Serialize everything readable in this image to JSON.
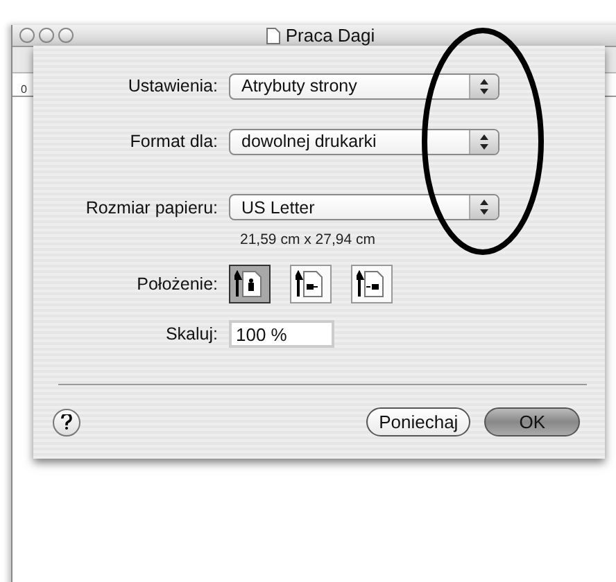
{
  "window": {
    "title": "Praca Dagi"
  },
  "ruler": {
    "label": "0"
  },
  "sheet": {
    "popups": [
      {
        "label": "Ustawienia:",
        "value": "Atrybuty strony"
      },
      {
        "label": "Format dla:",
        "value": "dowolnej drukarki"
      },
      {
        "label": "Rozmiar papieru:",
        "value": "US Letter"
      }
    ],
    "paper_size": "21,59 cm x 27,94 cm",
    "orientation": {
      "label": "Położenie:",
      "options": [
        {
          "kind": "portrait",
          "selected": true
        },
        {
          "kind": "landscape-left",
          "selected": false
        },
        {
          "kind": "landscape-right",
          "selected": false
        }
      ]
    },
    "scale": {
      "label": "Skaluj:",
      "value": "100 %"
    },
    "buttons": [
      {
        "label": "Poniechaj",
        "default": false
      },
      {
        "label": "OK",
        "default": true
      }
    ]
  },
  "annotation": {
    "ellipse": true
  }
}
